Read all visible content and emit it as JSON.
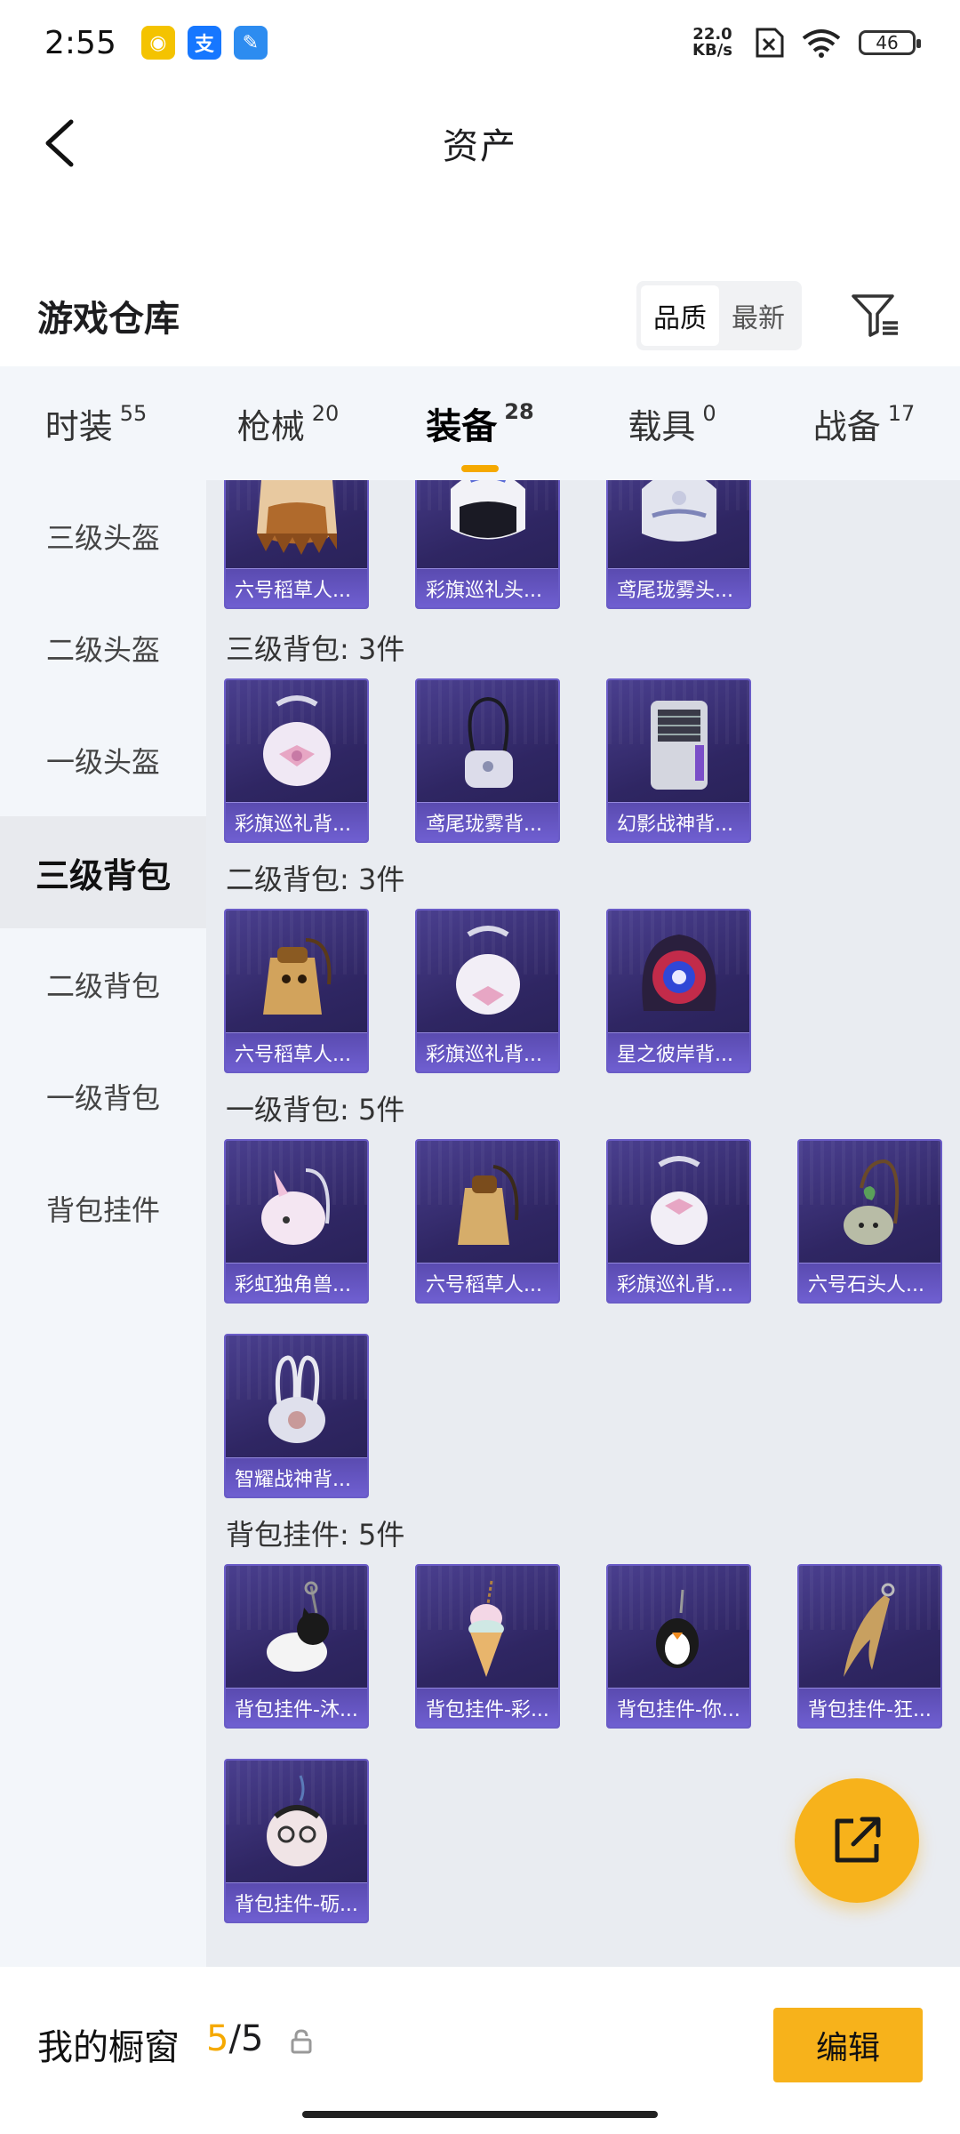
{
  "status_bar": {
    "time": "2:55",
    "net_speed_value": "22.0",
    "net_speed_unit": "KB/s",
    "battery": "46",
    "apps": [
      {
        "icon": "pawprint-app-icon",
        "color": "#f4c300",
        "glyph": "◉"
      },
      {
        "icon": "alipay-app-icon",
        "color": "#1677ff",
        "glyph": "支"
      },
      {
        "icon": "feather-app-icon",
        "color": "#2d8cf0",
        "glyph": "✎"
      }
    ]
  },
  "header": {
    "title": "资产"
  },
  "warehouse": {
    "title": "游戏仓库",
    "sort_options": [
      "品质",
      "最新"
    ],
    "active_sort": "品质"
  },
  "tabs": [
    {
      "label": "时装",
      "count": "55",
      "active": false
    },
    {
      "label": "枪械",
      "count": "20",
      "active": false
    },
    {
      "label": "装备",
      "count": "28",
      "active": true
    },
    {
      "label": "载具",
      "count": "0",
      "active": false
    },
    {
      "label": "战备",
      "count": "17",
      "active": false
    }
  ],
  "sidebar": [
    {
      "label": "三级头盔",
      "active": false
    },
    {
      "label": "二级头盔",
      "active": false
    },
    {
      "label": "一级头盔",
      "active": false
    },
    {
      "label": "三级背包",
      "active": true
    },
    {
      "label": "二级背包",
      "active": false
    },
    {
      "label": "一级背包",
      "active": false
    },
    {
      "label": "背包挂件",
      "active": false
    }
  ],
  "content": {
    "top_partial_items": [
      {
        "label": "六号稻草人...",
        "icon": "scarecrow-helmet-icon"
      },
      {
        "label": "彩旗巡礼头...",
        "icon": "white-helmet-icon"
      },
      {
        "label": "鸢尾珑雾头...",
        "icon": "silver-helmet-icon"
      }
    ],
    "sections": [
      {
        "title": "三级背包: 3件",
        "items": [
          {
            "label": "彩旗巡礼背...",
            "icon": "ribbon-backpack-icon"
          },
          {
            "label": "鸢尾珑雾背...",
            "icon": "mist-backpack-icon"
          },
          {
            "label": "幻影战神背...",
            "icon": "armored-backpack-icon"
          }
        ]
      },
      {
        "title": "二级背包: 3件",
        "items": [
          {
            "label": "六号稻草人...",
            "icon": "scarecrow-backpack-icon"
          },
          {
            "label": "彩旗巡礼背...",
            "icon": "ribbon-backpack-icon"
          },
          {
            "label": "星之彼岸背...",
            "icon": "eye-backpack-icon"
          }
        ]
      },
      {
        "title": "一级背包: 5件",
        "items": [
          {
            "label": "彩虹独角兽...",
            "icon": "unicorn-backpack-icon"
          },
          {
            "label": "六号稻草人...",
            "icon": "scarecrow-backpack-icon"
          },
          {
            "label": "彩旗巡礼背...",
            "icon": "ribbon-backpack-icon"
          },
          {
            "label": "六号石头人...",
            "icon": "stone-backpack-icon"
          },
          {
            "label": "智耀战神背...",
            "icon": "orb-backpack-icon"
          }
        ]
      },
      {
        "title": "背包挂件: 5件",
        "items": [
          {
            "label": "背包挂件-沐...",
            "icon": "cat-charm-icon"
          },
          {
            "label": "背包挂件-彩...",
            "icon": "icecream-charm-icon"
          },
          {
            "label": "背包挂件-你...",
            "icon": "penguin-charm-icon"
          },
          {
            "label": "背包挂件-狂...",
            "icon": "blade-charm-icon"
          },
          {
            "label": "背包挂件-砺...",
            "icon": "bear-charm-icon"
          }
        ]
      }
    ]
  },
  "showcase": {
    "title": "我的橱窗",
    "current": "5",
    "separator": "/",
    "total": "5",
    "edit_label": "编辑"
  },
  "colors": {
    "accent": "#f5a900",
    "card_bg": "#2f2663",
    "card_label_bg": "#6f5fd1"
  }
}
